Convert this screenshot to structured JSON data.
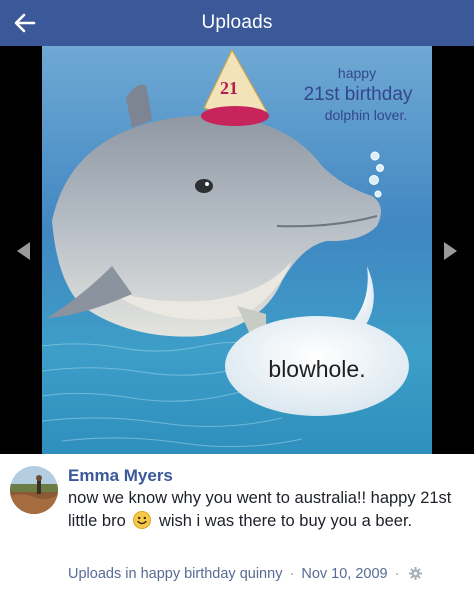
{
  "header": {
    "title": "Uploads",
    "back_icon": "arrow-left-icon",
    "background": "#3b5998"
  },
  "photo": {
    "caption_line1": "happy",
    "caption_line2": "21st birthday",
    "caption_line3": "dolphin lover.",
    "speech_bubble": "blowhole.",
    "hat_number": "21",
    "prev_icon": "caret-left-icon",
    "next_icon": "caret-right-icon"
  },
  "post": {
    "author": "Emma Myers",
    "message_before_emoji": "now we know why you went to australia!! happy 21st little bro",
    "emoji": "smiley-face-icon",
    "message_after_emoji": "wish i was there to buy you a beer.",
    "meta": {
      "album_link": "Uploads",
      "in_word": "in",
      "album_name": "happy birthday quinny",
      "separator": "·",
      "date": "Nov 10, 2009",
      "privacy_icon": "gear-icon"
    }
  },
  "colors": {
    "brand": "#3b5998",
    "link": "#576b95",
    "text": "#1d2129"
  }
}
